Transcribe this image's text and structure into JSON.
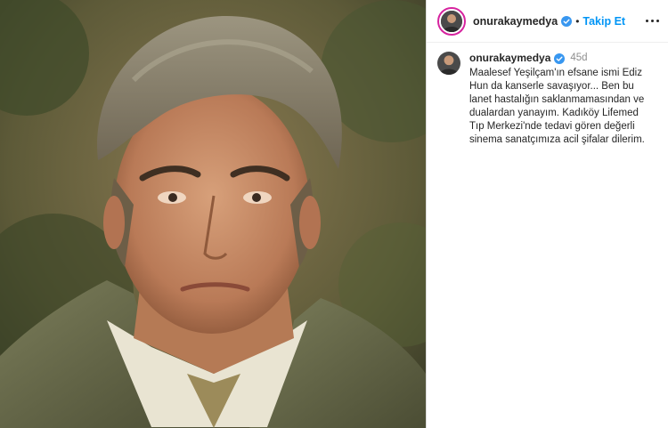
{
  "post": {
    "image_alt": "portrait photo",
    "header": {
      "username": "onurakaymedya",
      "separator": "•",
      "follow_label": "Takip Et"
    },
    "caption": {
      "username": "onurakaymedya",
      "time_ago": "45d",
      "text": "Maalesef Yeşilçam'ın efsane ismi Ediz Hun da kanserle savaşıyor... Ben bu lanet hastalığın saklanmamasından ve dualardan yanayım. Kadıköy Lifemed Tıp Merkezi'nde tedavi gören değerli sinema sanatçımıza acil şifalar dilerim."
    }
  },
  "icons": {
    "verified": "verified-badge-icon",
    "more": "more-options-icon"
  },
  "colors": {
    "link_blue": "#0095f6",
    "verified_blue": "#3897f0",
    "text": "#262626",
    "muted": "#8e8e8e"
  }
}
